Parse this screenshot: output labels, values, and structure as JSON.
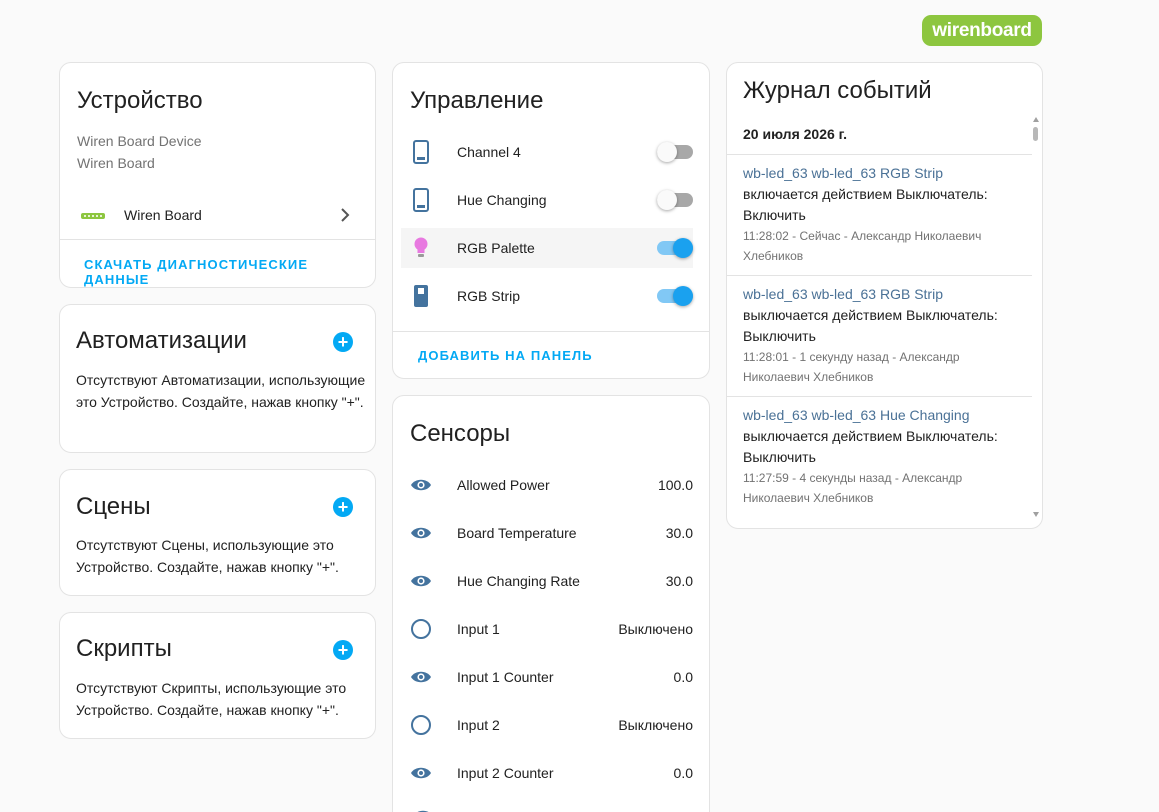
{
  "brand": {
    "logo_text": "wirenboard",
    "color": "#8dc63f"
  },
  "accent": "#03a9f4",
  "device": {
    "title": "Устройство",
    "model": "Wiren Board Device",
    "manufacturer": "Wiren Board",
    "link_label": "Wiren Board",
    "download_label": "Скачать диагностические данные"
  },
  "automations": {
    "title": "Автоматизации",
    "empty_text": "Отсутствуют Автоматизации, использующие это Устройство. Создайте, нажав кнопку \"+\"."
  },
  "scenes": {
    "title": "Сцены",
    "empty_text": "Отсутствуют Сцены, использующие это Устройство. Создайте, нажав кнопку \"+\"."
  },
  "scripts": {
    "title": "Скрипты",
    "empty_text": "Отсутствуют Скрипты, использующие это Устройство. Создайте, нажав кнопку \"+\"."
  },
  "controls": {
    "title": "Управление",
    "add_label": "Добавить на панель",
    "items": [
      {
        "label": "Channel 4",
        "icon": "phone-icon",
        "on": false
      },
      {
        "label": "Hue Changing",
        "icon": "phone-icon",
        "on": false
      },
      {
        "label": "RGB Palette",
        "icon": "lightbulb-icon",
        "on": true
      },
      {
        "label": "RGB Strip",
        "icon": "switch-icon",
        "on": true
      }
    ]
  },
  "sensors": {
    "title": "Сенсоры",
    "items": [
      {
        "label": "Allowed Power",
        "value": "100.0",
        "icon": "eye-icon"
      },
      {
        "label": "Board Temperature",
        "value": "30.0",
        "icon": "eye-icon"
      },
      {
        "label": "Hue Changing Rate",
        "value": "30.0",
        "icon": "eye-icon"
      },
      {
        "label": "Input 1",
        "value": "Выключено",
        "icon": "circle-outline-icon"
      },
      {
        "label": "Input 1 Counter",
        "value": "0.0",
        "icon": "eye-icon"
      },
      {
        "label": "Input 2",
        "value": "Выключено",
        "icon": "circle-outline-icon"
      },
      {
        "label": "Input 2 Counter",
        "value": "0.0",
        "icon": "eye-icon"
      }
    ]
  },
  "logbook": {
    "title": "Журнал событий",
    "date": "20 июля 2026 г.",
    "entries": [
      {
        "name": "wb-led_63 wb-led_63 RGB Strip",
        "msg": "включается действием Выключатель: Включить",
        "meta": "11:28:02 - Сейчас - Александр Николаевич Хлебников"
      },
      {
        "name": "wb-led_63 wb-led_63 RGB Strip",
        "msg": "выключается действием Выключатель: Выключить",
        "meta": "11:28:01 - 1 секунду назад - Александр Николаевич Хлебников"
      },
      {
        "name": "wb-led_63 wb-led_63 Hue Changing",
        "msg": "выключается действием Выключатель: Выключить",
        "meta": "11:27:59 - 4 секунды назад - Александр Николаевич Хлебников"
      }
    ]
  }
}
